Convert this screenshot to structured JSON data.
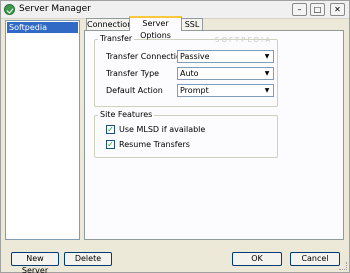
{
  "window": {
    "title": "Server Manager",
    "icons": [
      "server-manager-icon",
      "minimize-icon",
      "maximize-icon",
      "close-icon"
    ]
  },
  "tree": {
    "items": [
      {
        "label": "Softpedia",
        "selected": true
      }
    ]
  },
  "tabs": [
    {
      "label": "Connection",
      "active": false
    },
    {
      "label": "Server Options",
      "active": true
    },
    {
      "label": "SSL",
      "active": false
    }
  ],
  "transfer": {
    "legend": "Transfer",
    "rows": [
      {
        "label": "Transfer Connection",
        "value": "Passive"
      },
      {
        "label": "Transfer Type",
        "value": "Auto"
      },
      {
        "label": "Default Action",
        "value": "Prompt"
      }
    ]
  },
  "site_features": {
    "legend": "Site Features",
    "options": [
      {
        "label": "Use MLSD if available",
        "checked": true
      },
      {
        "label": "Resume Transfers",
        "checked": true
      }
    ]
  },
  "watermark": "SOFTPEDIA",
  "buttons": {
    "new_server": "New Server",
    "delete": "Delete",
    "ok": "OK",
    "cancel": "Cancel"
  }
}
